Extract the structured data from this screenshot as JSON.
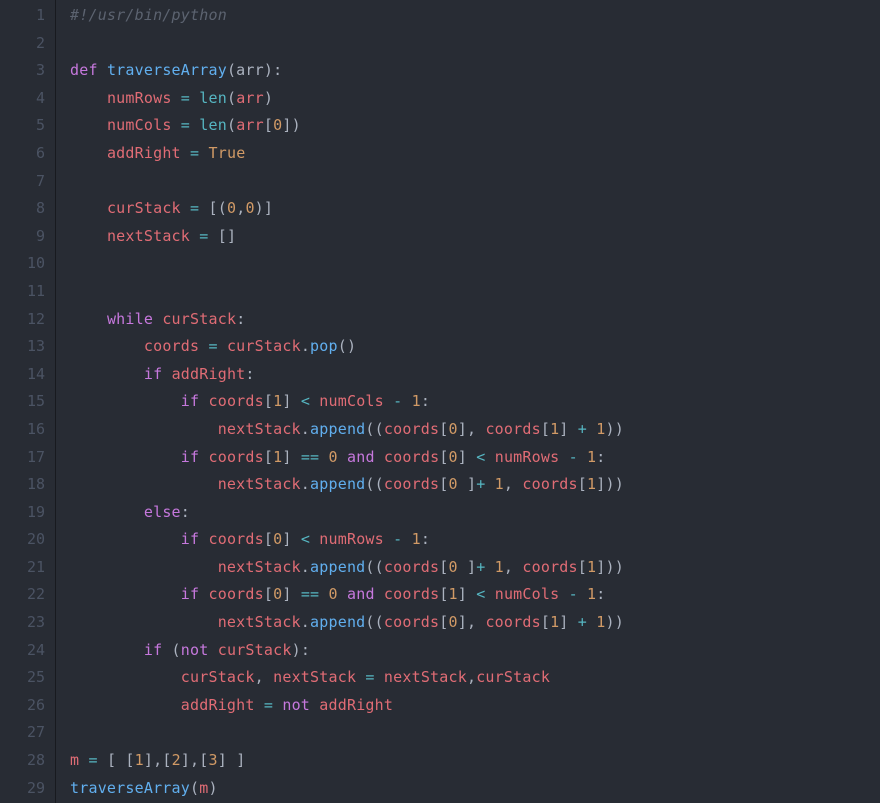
{
  "editor": {
    "lineNumbers": [
      "1",
      "2",
      "3",
      "4",
      "5",
      "6",
      "7",
      "8",
      "9",
      "10",
      "11",
      "12",
      "13",
      "14",
      "15",
      "16",
      "17",
      "18",
      "19",
      "20",
      "21",
      "22",
      "23",
      "24",
      "25",
      "26",
      "27",
      "28",
      "29"
    ],
    "lines": [
      [
        [
          "c-comment",
          "#!/usr/bin/python"
        ]
      ],
      [],
      [
        [
          "c-keyword",
          "def"
        ],
        [
          "c-plain",
          " "
        ],
        [
          "c-funcname",
          "traverseArray"
        ],
        [
          "c-punct",
          "("
        ],
        [
          "c-param",
          "arr"
        ],
        [
          "c-punct",
          "):"
        ]
      ],
      [
        [
          "c-plain",
          "    "
        ],
        [
          "c-var",
          "numRows"
        ],
        [
          "c-plain",
          " "
        ],
        [
          "c-op",
          "="
        ],
        [
          "c-plain",
          " "
        ],
        [
          "c-builtin",
          "len"
        ],
        [
          "c-punct",
          "("
        ],
        [
          "c-var",
          "arr"
        ],
        [
          "c-punct",
          ")"
        ]
      ],
      [
        [
          "c-plain",
          "    "
        ],
        [
          "c-var",
          "numCols"
        ],
        [
          "c-plain",
          " "
        ],
        [
          "c-op",
          "="
        ],
        [
          "c-plain",
          " "
        ],
        [
          "c-builtin",
          "len"
        ],
        [
          "c-punct",
          "("
        ],
        [
          "c-var",
          "arr"
        ],
        [
          "c-punct",
          "["
        ],
        [
          "c-num",
          "0"
        ],
        [
          "c-punct",
          "])"
        ]
      ],
      [
        [
          "c-plain",
          "    "
        ],
        [
          "c-var",
          "addRight"
        ],
        [
          "c-plain",
          " "
        ],
        [
          "c-op",
          "="
        ],
        [
          "c-plain",
          " "
        ],
        [
          "c-const",
          "True"
        ]
      ],
      [],
      [
        [
          "c-plain",
          "    "
        ],
        [
          "c-var",
          "curStack"
        ],
        [
          "c-plain",
          " "
        ],
        [
          "c-op",
          "="
        ],
        [
          "c-plain",
          " "
        ],
        [
          "c-punct",
          "[("
        ],
        [
          "c-num",
          "0"
        ],
        [
          "c-punct",
          ","
        ],
        [
          "c-num",
          "0"
        ],
        [
          "c-punct",
          ")]"
        ]
      ],
      [
        [
          "c-plain",
          "    "
        ],
        [
          "c-var",
          "nextStack"
        ],
        [
          "c-plain",
          " "
        ],
        [
          "c-op",
          "="
        ],
        [
          "c-plain",
          " "
        ],
        [
          "c-punct",
          "[]"
        ]
      ],
      [],
      [],
      [
        [
          "c-plain",
          "    "
        ],
        [
          "c-keyword",
          "while"
        ],
        [
          "c-plain",
          " "
        ],
        [
          "c-var",
          "curStack"
        ],
        [
          "c-punct",
          ":"
        ]
      ],
      [
        [
          "c-plain",
          "        "
        ],
        [
          "c-var",
          "coords"
        ],
        [
          "c-plain",
          " "
        ],
        [
          "c-op",
          "="
        ],
        [
          "c-plain",
          " "
        ],
        [
          "c-var",
          "curStack"
        ],
        [
          "c-punct",
          "."
        ],
        [
          "c-method",
          "pop"
        ],
        [
          "c-punct",
          "()"
        ]
      ],
      [
        [
          "c-plain",
          "        "
        ],
        [
          "c-keyword",
          "if"
        ],
        [
          "c-plain",
          " "
        ],
        [
          "c-var",
          "addRight"
        ],
        [
          "c-punct",
          ":"
        ]
      ],
      [
        [
          "c-plain",
          "            "
        ],
        [
          "c-keyword",
          "if"
        ],
        [
          "c-plain",
          " "
        ],
        [
          "c-var",
          "coords"
        ],
        [
          "c-punct",
          "["
        ],
        [
          "c-num",
          "1"
        ],
        [
          "c-punct",
          "]"
        ],
        [
          "c-plain",
          " "
        ],
        [
          "c-op",
          "<"
        ],
        [
          "c-plain",
          " "
        ],
        [
          "c-var",
          "numCols"
        ],
        [
          "c-plain",
          " "
        ],
        [
          "c-op",
          "-"
        ],
        [
          "c-plain",
          " "
        ],
        [
          "c-num",
          "1"
        ],
        [
          "c-punct",
          ":"
        ]
      ],
      [
        [
          "c-plain",
          "                "
        ],
        [
          "c-var",
          "nextStack"
        ],
        [
          "c-punct",
          "."
        ],
        [
          "c-method",
          "append"
        ],
        [
          "c-punct",
          "(("
        ],
        [
          "c-var",
          "coords"
        ],
        [
          "c-punct",
          "["
        ],
        [
          "c-num",
          "0"
        ],
        [
          "c-punct",
          "], "
        ],
        [
          "c-var",
          "coords"
        ],
        [
          "c-punct",
          "["
        ],
        [
          "c-num",
          "1"
        ],
        [
          "c-punct",
          "] "
        ],
        [
          "c-op",
          "+"
        ],
        [
          "c-plain",
          " "
        ],
        [
          "c-num",
          "1"
        ],
        [
          "c-punct",
          "))"
        ]
      ],
      [
        [
          "c-plain",
          "            "
        ],
        [
          "c-keyword",
          "if"
        ],
        [
          "c-plain",
          " "
        ],
        [
          "c-var",
          "coords"
        ],
        [
          "c-punct",
          "["
        ],
        [
          "c-num",
          "1"
        ],
        [
          "c-punct",
          "]"
        ],
        [
          "c-plain",
          " "
        ],
        [
          "c-op",
          "=="
        ],
        [
          "c-plain",
          " "
        ],
        [
          "c-num",
          "0"
        ],
        [
          "c-plain",
          " "
        ],
        [
          "c-keyword",
          "and"
        ],
        [
          "c-plain",
          " "
        ],
        [
          "c-var",
          "coords"
        ],
        [
          "c-punct",
          "["
        ],
        [
          "c-num",
          "0"
        ],
        [
          "c-punct",
          "]"
        ],
        [
          "c-plain",
          " "
        ],
        [
          "c-op",
          "<"
        ],
        [
          "c-plain",
          " "
        ],
        [
          "c-var",
          "numRows"
        ],
        [
          "c-plain",
          " "
        ],
        [
          "c-op",
          "-"
        ],
        [
          "c-plain",
          " "
        ],
        [
          "c-num",
          "1"
        ],
        [
          "c-punct",
          ":"
        ]
      ],
      [
        [
          "c-plain",
          "                "
        ],
        [
          "c-var",
          "nextStack"
        ],
        [
          "c-punct",
          "."
        ],
        [
          "c-method",
          "append"
        ],
        [
          "c-punct",
          "(("
        ],
        [
          "c-var",
          "coords"
        ],
        [
          "c-punct",
          "["
        ],
        [
          "c-num",
          "0"
        ],
        [
          "c-plain",
          " "
        ],
        [
          "c-punct",
          "]"
        ],
        [
          "c-op",
          "+"
        ],
        [
          "c-plain",
          " "
        ],
        [
          "c-num",
          "1"
        ],
        [
          "c-punct",
          ", "
        ],
        [
          "c-var",
          "coords"
        ],
        [
          "c-punct",
          "["
        ],
        [
          "c-num",
          "1"
        ],
        [
          "c-punct",
          "]))"
        ]
      ],
      [
        [
          "c-plain",
          "        "
        ],
        [
          "c-keyword",
          "else"
        ],
        [
          "c-punct",
          ":"
        ]
      ],
      [
        [
          "c-plain",
          "            "
        ],
        [
          "c-keyword",
          "if"
        ],
        [
          "c-plain",
          " "
        ],
        [
          "c-var",
          "coords"
        ],
        [
          "c-punct",
          "["
        ],
        [
          "c-num",
          "0"
        ],
        [
          "c-punct",
          "]"
        ],
        [
          "c-plain",
          " "
        ],
        [
          "c-op",
          "<"
        ],
        [
          "c-plain",
          " "
        ],
        [
          "c-var",
          "numRows"
        ],
        [
          "c-plain",
          " "
        ],
        [
          "c-op",
          "-"
        ],
        [
          "c-plain",
          " "
        ],
        [
          "c-num",
          "1"
        ],
        [
          "c-punct",
          ":"
        ]
      ],
      [
        [
          "c-plain",
          "                "
        ],
        [
          "c-var",
          "nextStack"
        ],
        [
          "c-punct",
          "."
        ],
        [
          "c-method",
          "append"
        ],
        [
          "c-punct",
          "(("
        ],
        [
          "c-var",
          "coords"
        ],
        [
          "c-punct",
          "["
        ],
        [
          "c-num",
          "0"
        ],
        [
          "c-plain",
          " "
        ],
        [
          "c-punct",
          "]"
        ],
        [
          "c-op",
          "+"
        ],
        [
          "c-plain",
          " "
        ],
        [
          "c-num",
          "1"
        ],
        [
          "c-punct",
          ", "
        ],
        [
          "c-var",
          "coords"
        ],
        [
          "c-punct",
          "["
        ],
        [
          "c-num",
          "1"
        ],
        [
          "c-punct",
          "]))"
        ]
      ],
      [
        [
          "c-plain",
          "            "
        ],
        [
          "c-keyword",
          "if"
        ],
        [
          "c-plain",
          " "
        ],
        [
          "c-var",
          "coords"
        ],
        [
          "c-punct",
          "["
        ],
        [
          "c-num",
          "0"
        ],
        [
          "c-punct",
          "]"
        ],
        [
          "c-plain",
          " "
        ],
        [
          "c-op",
          "=="
        ],
        [
          "c-plain",
          " "
        ],
        [
          "c-num",
          "0"
        ],
        [
          "c-plain",
          " "
        ],
        [
          "c-keyword",
          "and"
        ],
        [
          "c-plain",
          " "
        ],
        [
          "c-var",
          "coords"
        ],
        [
          "c-punct",
          "["
        ],
        [
          "c-num",
          "1"
        ],
        [
          "c-punct",
          "]"
        ],
        [
          "c-plain",
          " "
        ],
        [
          "c-op",
          "<"
        ],
        [
          "c-plain",
          " "
        ],
        [
          "c-var",
          "numCols"
        ],
        [
          "c-plain",
          " "
        ],
        [
          "c-op",
          "-"
        ],
        [
          "c-plain",
          " "
        ],
        [
          "c-num",
          "1"
        ],
        [
          "c-punct",
          ":"
        ]
      ],
      [
        [
          "c-plain",
          "                "
        ],
        [
          "c-var",
          "nextStack"
        ],
        [
          "c-punct",
          "."
        ],
        [
          "c-method",
          "append"
        ],
        [
          "c-punct",
          "(("
        ],
        [
          "c-var",
          "coords"
        ],
        [
          "c-punct",
          "["
        ],
        [
          "c-num",
          "0"
        ],
        [
          "c-punct",
          "], "
        ],
        [
          "c-var",
          "coords"
        ],
        [
          "c-punct",
          "["
        ],
        [
          "c-num",
          "1"
        ],
        [
          "c-punct",
          "] "
        ],
        [
          "c-op",
          "+"
        ],
        [
          "c-plain",
          " "
        ],
        [
          "c-num",
          "1"
        ],
        [
          "c-punct",
          "))"
        ]
      ],
      [
        [
          "c-plain",
          "        "
        ],
        [
          "c-keyword",
          "if"
        ],
        [
          "c-plain",
          " ("
        ],
        [
          "c-keyword",
          "not"
        ],
        [
          "c-plain",
          " "
        ],
        [
          "c-var",
          "curStack"
        ],
        [
          "c-punct",
          "):"
        ]
      ],
      [
        [
          "c-plain",
          "            "
        ],
        [
          "c-var",
          "curStack"
        ],
        [
          "c-punct",
          ", "
        ],
        [
          "c-var",
          "nextStack"
        ],
        [
          "c-plain",
          " "
        ],
        [
          "c-op",
          "="
        ],
        [
          "c-plain",
          " "
        ],
        [
          "c-var",
          "nextStack"
        ],
        [
          "c-punct",
          ","
        ],
        [
          "c-var",
          "curStack"
        ]
      ],
      [
        [
          "c-plain",
          "            "
        ],
        [
          "c-var",
          "addRight"
        ],
        [
          "c-plain",
          " "
        ],
        [
          "c-op",
          "="
        ],
        [
          "c-plain",
          " "
        ],
        [
          "c-keyword",
          "not"
        ],
        [
          "c-plain",
          " "
        ],
        [
          "c-var",
          "addRight"
        ]
      ],
      [],
      [
        [
          "c-var",
          "m"
        ],
        [
          "c-plain",
          " "
        ],
        [
          "c-op",
          "="
        ],
        [
          "c-plain",
          " "
        ],
        [
          "c-punct",
          "[ ["
        ],
        [
          "c-num",
          "1"
        ],
        [
          "c-punct",
          "],["
        ],
        [
          "c-num",
          "2"
        ],
        [
          "c-punct",
          "],["
        ],
        [
          "c-num",
          "3"
        ],
        [
          "c-punct",
          "] ]"
        ]
      ],
      [
        [
          "c-funcname",
          "traverseArray"
        ],
        [
          "c-punct",
          "("
        ],
        [
          "c-var",
          "m"
        ],
        [
          "c-punct",
          ")"
        ]
      ]
    ]
  }
}
